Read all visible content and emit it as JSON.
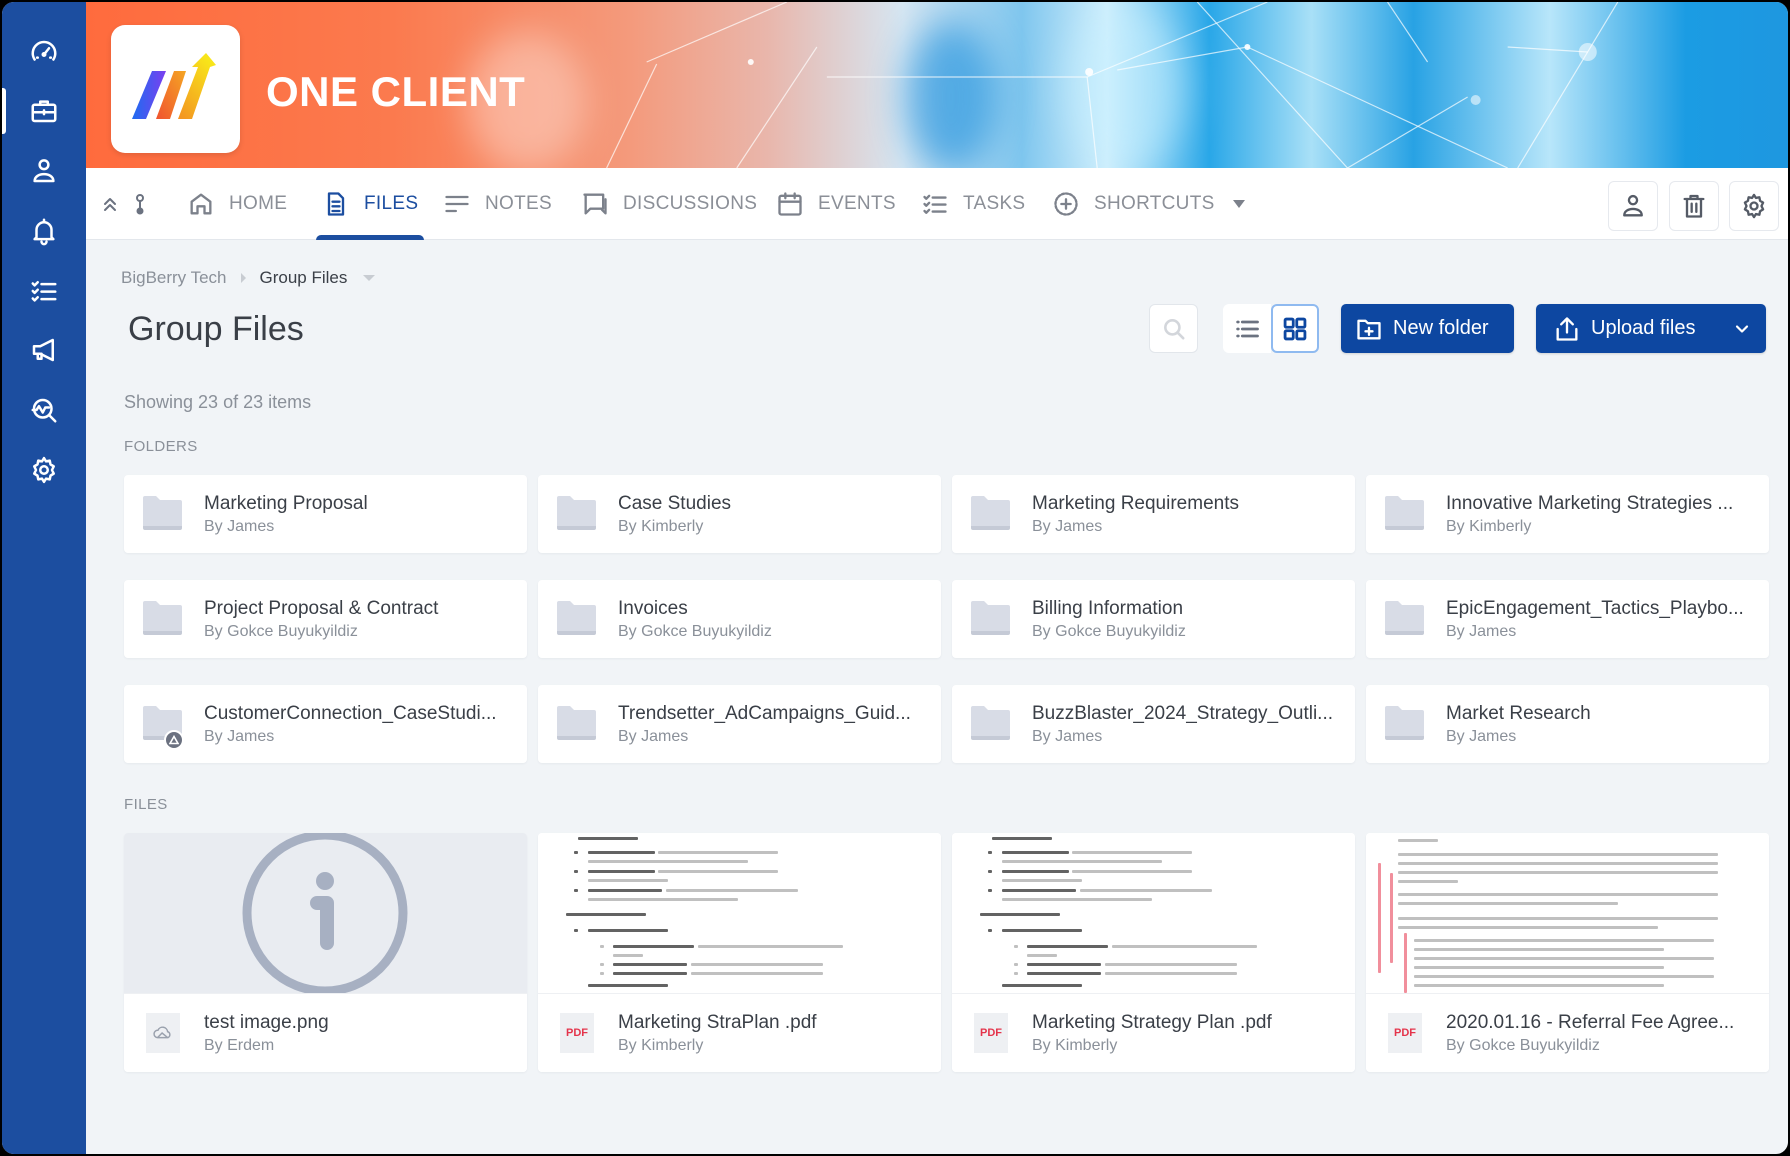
{
  "app": {
    "title": "ONE CLIENT",
    "colors": {
      "primary": "#0d47a1",
      "sidebar": "#1c4ea0",
      "background": "#f1f4f7",
      "pdf_badge": "#e4344b"
    }
  },
  "sidebar": {
    "items": [
      {
        "name": "dashboard",
        "icon": "gauge-icon",
        "active": false
      },
      {
        "name": "workspaces",
        "icon": "briefcase-icon",
        "active": true
      },
      {
        "name": "contacts",
        "icon": "user-icon",
        "active": false
      },
      {
        "name": "notifications",
        "icon": "bell-icon",
        "active": false
      },
      {
        "name": "tasks",
        "icon": "checklist-icon",
        "active": false
      },
      {
        "name": "announcements",
        "icon": "megaphone-icon",
        "active": false
      },
      {
        "name": "analytics",
        "icon": "search-analytics-icon",
        "active": false
      },
      {
        "name": "settings",
        "icon": "gear-icon",
        "active": false
      }
    ]
  },
  "nav": {
    "tabs": [
      {
        "label": "HOME",
        "icon": "home-icon",
        "active": false
      },
      {
        "label": "FILES",
        "icon": "file-icon",
        "active": true
      },
      {
        "label": "NOTES",
        "icon": "notes-icon",
        "active": false
      },
      {
        "label": "DISCUSSIONS",
        "icon": "chat-icon",
        "active": false
      },
      {
        "label": "EVENTS",
        "icon": "calendar-icon",
        "active": false
      },
      {
        "label": "TASKS",
        "icon": "checklist-icon",
        "active": false
      },
      {
        "label": "SHORTCUTS",
        "icon": "plus-circle-icon",
        "active": false,
        "has_dropdown": true
      }
    ],
    "right_buttons": [
      "user-icon",
      "trash-icon",
      "gear-icon"
    ]
  },
  "breadcrumb": {
    "items": [
      "BigBerry Tech",
      "Group Files"
    ]
  },
  "page": {
    "title": "Group Files",
    "showing": "Showing 23 of 23 items",
    "folders_label": "FOLDERS",
    "files_label": "FILES"
  },
  "toolbar": {
    "view_mode": "grid",
    "new_folder_label": "New folder",
    "upload_label": "Upload files"
  },
  "folders": [
    {
      "name": "Marketing Proposal",
      "by": "By James",
      "shared": false
    },
    {
      "name": "Case Studies",
      "by": "By Kimberly",
      "shared": false
    },
    {
      "name": "Marketing Requirements",
      "by": "By James",
      "shared": false
    },
    {
      "name": "Innovative Marketing Strategies ...",
      "by": "By Kimberly",
      "shared": false
    },
    {
      "name": "Project Proposal & Contract",
      "by": "By Gokce Buyukyildiz",
      "shared": false
    },
    {
      "name": "Invoices",
      "by": "By Gokce Buyukyildiz",
      "shared": false
    },
    {
      "name": "Billing Information",
      "by": "By Gokce Buyukyildiz",
      "shared": false
    },
    {
      "name": "EpicEngagement_Tactics_Playbo...",
      "by": "By James",
      "shared": false
    },
    {
      "name": "CustomerConnection_CaseStudi...",
      "by": "By James",
      "shared": true
    },
    {
      "name": "Trendsetter_AdCampaigns_Guid...",
      "by": "By James",
      "shared": false
    },
    {
      "name": "BuzzBlaster_2024_Strategy_Outli...",
      "by": "By James",
      "shared": false
    },
    {
      "name": "Market Research",
      "by": "By James",
      "shared": false
    }
  ],
  "files": [
    {
      "name": "test image.png",
      "by": "By Erdem",
      "type": "image",
      "type_label": "",
      "preview": "info-placeholder"
    },
    {
      "name": "Marketing StraPlan .pdf",
      "by": "By Kimberly",
      "type": "pdf",
      "type_label": "PDF",
      "preview": "document"
    },
    {
      "name": "Marketing Strategy Plan .pdf",
      "by": "By Kimberly",
      "type": "pdf",
      "type_label": "PDF",
      "preview": "document"
    },
    {
      "name": "2020.01.16 - Referral Fee Agree...",
      "by": "By Gokce Buyukyildiz",
      "type": "pdf",
      "type_label": "PDF",
      "preview": "contract"
    }
  ]
}
